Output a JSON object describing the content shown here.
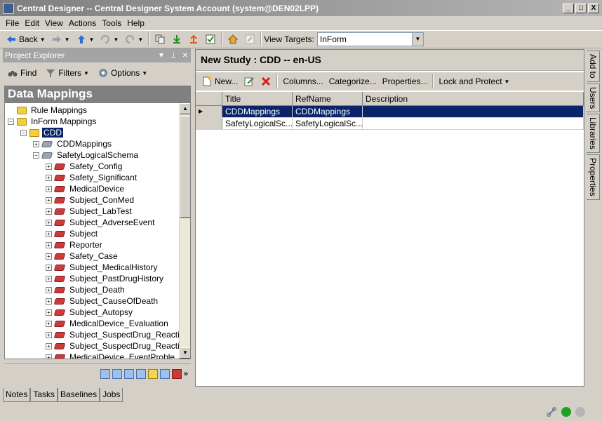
{
  "window": {
    "title": "Central Designer -- Central Designer System Account (system@DEN02LPP)",
    "min": "_",
    "max": "□",
    "close": "X"
  },
  "menu": [
    "File",
    "Edit",
    "View",
    "Actions",
    "Tools",
    "Help"
  ],
  "toolbar": {
    "back_label": "Back",
    "view_targets_label": "View Targets:",
    "view_targets_value": "InForm"
  },
  "project_explorer": {
    "title": "Project Explorer",
    "find_label": "Find",
    "filters_label": "Filters",
    "options_label": "Options",
    "section_title": "Data Mappings"
  },
  "tree": [
    {
      "label": "Rule Mappings",
      "level": 0,
      "icon": "folder",
      "exp": ""
    },
    {
      "label": "InForm Mappings",
      "level": 0,
      "icon": "folder",
      "exp": "−"
    },
    {
      "label": "CDD",
      "level": 1,
      "icon": "folder",
      "exp": "−",
      "selected": true
    },
    {
      "label": "CDDMappings",
      "level": 2,
      "icon": "book-gray",
      "exp": "+"
    },
    {
      "label": "SafetyLogicalSchema",
      "level": 2,
      "icon": "book-gray",
      "exp": "−"
    },
    {
      "label": "Safety_Config",
      "level": 3,
      "icon": "book",
      "exp": "+"
    },
    {
      "label": "Safety_Significant",
      "level": 3,
      "icon": "book",
      "exp": "+"
    },
    {
      "label": "MedicalDevice",
      "level": 3,
      "icon": "book",
      "exp": "+"
    },
    {
      "label": "Subject_ConMed",
      "level": 3,
      "icon": "book",
      "exp": "+"
    },
    {
      "label": "Subject_LabTest",
      "level": 3,
      "icon": "book",
      "exp": "+"
    },
    {
      "label": "Subject_AdverseEvent",
      "level": 3,
      "icon": "book",
      "exp": "+"
    },
    {
      "label": "Subject",
      "level": 3,
      "icon": "book",
      "exp": "+"
    },
    {
      "label": "Reporter",
      "level": 3,
      "icon": "book",
      "exp": "+"
    },
    {
      "label": "Safety_Case",
      "level": 3,
      "icon": "book",
      "exp": "+"
    },
    {
      "label": "Subject_MedicalHistory",
      "level": 3,
      "icon": "book",
      "exp": "+"
    },
    {
      "label": "Subject_PastDrugHistory",
      "level": 3,
      "icon": "book",
      "exp": "+"
    },
    {
      "label": "Subject_Death",
      "level": 3,
      "icon": "book",
      "exp": "+"
    },
    {
      "label": "Subject_CauseOfDeath",
      "level": 3,
      "icon": "book",
      "exp": "+"
    },
    {
      "label": "Subject_Autopsy",
      "level": 3,
      "icon": "book",
      "exp": "+"
    },
    {
      "label": "MedicalDevice_Evaluation",
      "level": 3,
      "icon": "book",
      "exp": "+"
    },
    {
      "label": "Subject_SuspectDrug_Reacti",
      "level": 3,
      "icon": "book",
      "exp": "+"
    },
    {
      "label": "Subject_SuspectDrug_Reacti",
      "level": 3,
      "icon": "book",
      "exp": "+"
    },
    {
      "label": "MedicalDevice_EventProble",
      "level": 3,
      "icon": "book",
      "exp": "+"
    }
  ],
  "bottom_tabs": [
    "Notes",
    "Tasks",
    "Baselines",
    "Jobs"
  ],
  "study": {
    "title": "New Study : CDD -- en-US",
    "new_label": "New...",
    "columns_label": "Columns...",
    "categorize_label": "Categorize...",
    "properties_label": "Properties...",
    "lock_label": "Lock and Protect"
  },
  "grid": {
    "headers": [
      "Title",
      "RefName",
      "Description"
    ],
    "rows": [
      {
        "title": "CDDMappings",
        "refname": "CDDMappings",
        "description": ""
      },
      {
        "title": "SafetyLogicalSc...",
        "refname": "SafetyLogicalSc...",
        "description": ""
      }
    ]
  },
  "side_tabs": [
    "Add to",
    "Users",
    "Libraries",
    "Properties"
  ],
  "colors": {
    "selection": "#0a246a",
    "status_green": "#1fa31f"
  }
}
